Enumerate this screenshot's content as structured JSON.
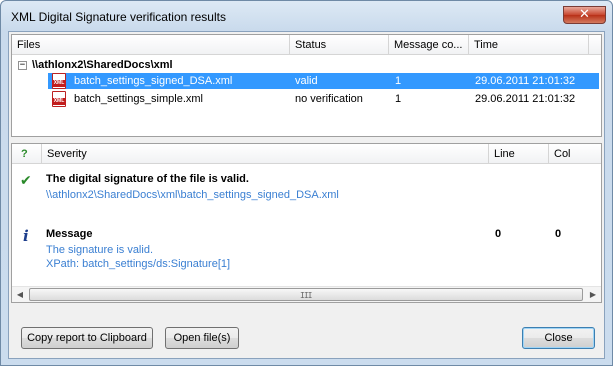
{
  "window": {
    "title": "XML Digital Signature verification results",
    "close_glyph": "✕"
  },
  "files": {
    "columns": [
      "Files",
      "Status",
      "Message co...",
      "Time"
    ],
    "root": {
      "toggle": "−",
      "label": "\\\\athlonx2\\SharedDocs\\xml"
    },
    "rows": [
      {
        "name": "batch_settings_signed_DSA.xml",
        "status": "valid",
        "messages": "1",
        "time": "29.06.2011 21:01:32",
        "selected": true
      },
      {
        "name": "batch_settings_simple.xml",
        "status": "no verification",
        "messages": "1",
        "time": "29.06.2011 21:01:32",
        "selected": false
      }
    ],
    "icon_text": "XML"
  },
  "messages": {
    "columns": [
      "?",
      "Severity",
      "Line",
      "Col"
    ],
    "items": [
      {
        "icon": "check-icon",
        "title": "The digital signature of the file is valid.",
        "details": [
          "\\\\athlonx2\\SharedDocs\\xml\\batch_settings_signed_DSA.xml"
        ],
        "line": "",
        "col": ""
      },
      {
        "icon": "info-icon",
        "title": "Message",
        "details": [
          "The signature is valid.",
          "XPath: batch_settings/ds:Signature[1]"
        ],
        "line": "0",
        "col": "0"
      }
    ],
    "scroll": {
      "left": "◀",
      "right": "▶",
      "grip": "III"
    }
  },
  "buttons": {
    "copy": "Copy report to Clipboard",
    "open": "Open file(s)",
    "close": "Close"
  },
  "colors": {
    "selection": "#3399ff",
    "link": "#3a7fd2",
    "check": "#2a8a2a",
    "info": "#1c3d8c"
  }
}
